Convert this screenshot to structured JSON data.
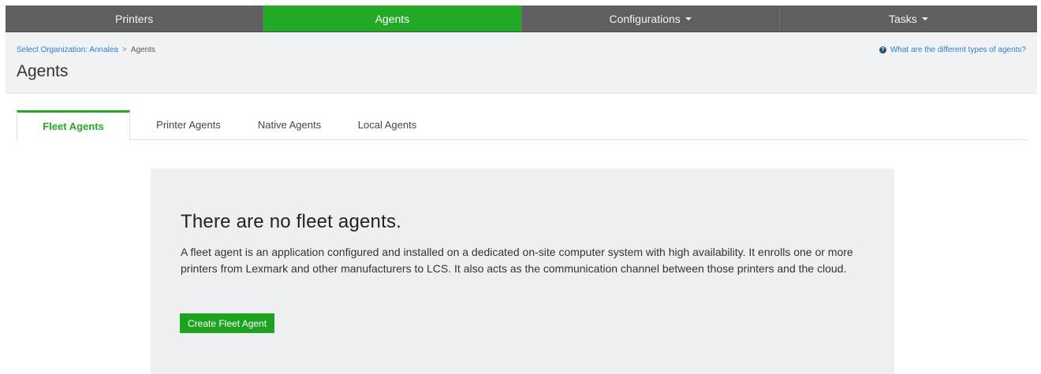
{
  "topnav": {
    "items": [
      {
        "label": "Printers",
        "has_dropdown": false,
        "active": false
      },
      {
        "label": "Agents",
        "has_dropdown": false,
        "active": true
      },
      {
        "label": "Configurations",
        "has_dropdown": true,
        "active": false
      },
      {
        "label": "Tasks",
        "has_dropdown": true,
        "active": false
      }
    ]
  },
  "breadcrumb": {
    "organization_link": "Select Organization: Annalea",
    "separator": ">",
    "current": "Agents"
  },
  "header": {
    "title": "Agents",
    "help_icon": "question-circle-icon",
    "help_link": "What are the different types of agents?"
  },
  "tabs": [
    {
      "label": "Fleet Agents",
      "active": true
    },
    {
      "label": "Printer Agents",
      "active": false
    },
    {
      "label": "Native Agents",
      "active": false
    },
    {
      "label": "Local Agents",
      "active": false
    }
  ],
  "empty_state": {
    "title": "There are no fleet agents.",
    "description": "A fleet agent is an application configured and installed on a dedicated on-site computer system with high availability. It enrolls one or more printers from Lexmark and other manufacturers to LCS. It also acts as the communication channel between those printers and the cloud.",
    "button_label": "Create Fleet Agent"
  },
  "colors": {
    "accent_green": "#23a925",
    "nav_background": "#5f5f5f",
    "link_blue": "#2e7dd7",
    "panel_background": "#eeeff1"
  }
}
